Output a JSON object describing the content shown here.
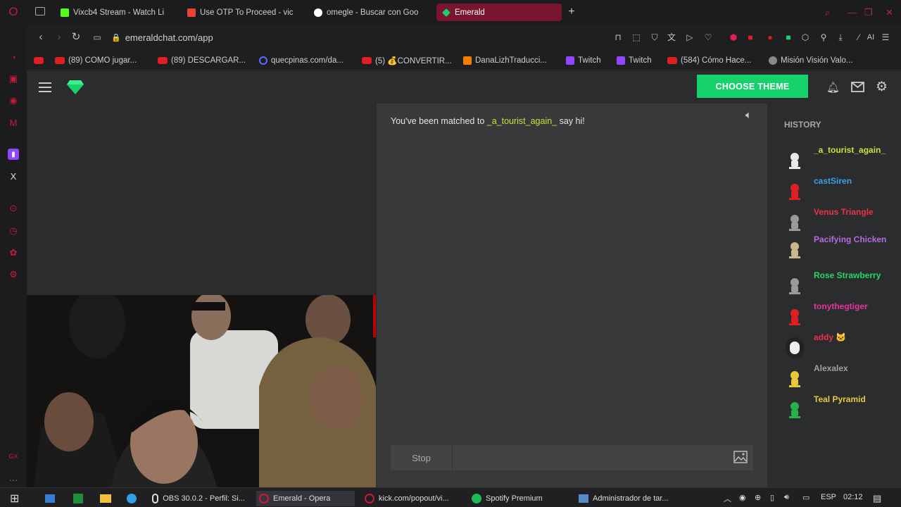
{
  "browser": {
    "tabs": [
      {
        "label": "Vixcb4 Stream - Watch Li",
        "favicon_color": "#53fc18"
      },
      {
        "label": "Use OTP To Proceed - vic",
        "favicon_color": "#ea4335"
      },
      {
        "label": "omegle - Buscar con Goo",
        "favicon_color": "#4285f4"
      },
      {
        "label": "Emerald",
        "favicon_color": "#17d16d",
        "active": true
      }
    ],
    "new_tab": "+",
    "url": "emeraldchat.com/app",
    "bookmarks": [
      {
        "label": "",
        "icon": "youtube-icon"
      },
      {
        "label": "(89) COMO jugar...",
        "icon": "youtube-icon"
      },
      {
        "label": "(89) DESCARGAR...",
        "icon": "youtube-icon"
      },
      {
        "label": "quecpinas.com/da...",
        "icon": "web-icon"
      },
      {
        "label": "(5) 💰CONVERTIR...",
        "icon": "youtube-icon"
      },
      {
        "label": "DanaLizhTraducci...",
        "icon": "blogger-icon"
      },
      {
        "label": "Twitch",
        "icon": "twitch-icon"
      },
      {
        "label": "Twitch",
        "icon": "twitch-icon"
      },
      {
        "label": "(584) Cómo Hace...",
        "icon": "youtube-icon"
      },
      {
        "label": "Misión Visión Valo...",
        "icon": "web-icon"
      }
    ],
    "toolbar_ai": "AI"
  },
  "app": {
    "choose_theme": "CHOOSE THEME",
    "chat": {
      "prefix": "You've been matched to ",
      "matched_user": "_a_tourist_again_",
      "suffix": " say hi!",
      "stop_label": "Stop",
      "input_placeholder": ""
    },
    "history": {
      "title": "HISTORY",
      "items": [
        {
          "name": "_a_tourist_again_",
          "color": "#c5e33a",
          "avatar": "white"
        },
        {
          "name": "castSiren",
          "color": "#3aa0e8",
          "avatar": "red"
        },
        {
          "name": "Venus Triangle",
          "color": "#e8334a",
          "avatar": "grey"
        },
        {
          "name": "Pacifying Chicken",
          "color": "#b76be0",
          "avatar": "tan"
        },
        {
          "name": "Rose Strawberry",
          "color": "#28d66a",
          "avatar": "grey"
        },
        {
          "name": "tonythegtiger",
          "color": "#e8339b",
          "avatar": "red"
        },
        {
          "name": "addy 🐱",
          "color": "#e8334a",
          "avatar": "photo"
        },
        {
          "name": "Alexalex",
          "color": "#a0a0a0",
          "avatar": "yellow"
        },
        {
          "name": "Teal Pyramid",
          "color": "#e8c93a",
          "avatar": "green"
        }
      ]
    }
  },
  "taskbar": {
    "items": [
      {
        "label": "",
        "icon": "start-icon"
      },
      {
        "label": "",
        "icon": "store-icon"
      },
      {
        "label": "",
        "icon": "excel-icon"
      },
      {
        "label": "",
        "icon": "folder-icon"
      },
      {
        "label": "",
        "icon": "edge-icon"
      },
      {
        "label": "OBS 30.0.2 - Perfil: Si...",
        "icon": "obs-icon"
      },
      {
        "label": "Emerald - Opera",
        "icon": "opera-icon"
      },
      {
        "label": "kick.com/popout/vi...",
        "icon": "opera-icon"
      },
      {
        "label": "Spotify Premium",
        "icon": "spotify-icon"
      },
      {
        "label": "Administrador de tar...",
        "icon": "taskmgr-icon"
      }
    ],
    "lang": "ESP",
    "time": "02:12"
  }
}
